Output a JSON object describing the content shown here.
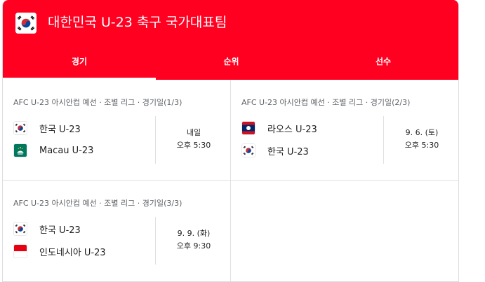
{
  "header": {
    "title": "대한민국 U-23 축구 국가대표팀",
    "tabs": [
      {
        "label": "경기",
        "active": true
      },
      {
        "label": "순위",
        "active": false
      },
      {
        "label": "선수",
        "active": false
      }
    ],
    "background_color": "#ff0021"
  },
  "matches": [
    {
      "competition": "AFC U-23 아시안컵 예선 · 조별 리그 · 경기일(1/3)",
      "teams": [
        {
          "name": "한국 U-23",
          "flag": "south-korea-flag-icon"
        },
        {
          "name": "Macau U-23",
          "flag": "macau-flag-icon"
        }
      ],
      "date": "내일",
      "time": "오후 5:30"
    },
    {
      "competition": "AFC U-23 아시안컵 예선 · 조별 리그 · 경기일(2/3)",
      "teams": [
        {
          "name": "라오스 U-23",
          "flag": "laos-flag-icon"
        },
        {
          "name": "한국 U-23",
          "flag": "south-korea-flag-icon"
        }
      ],
      "date": "9. 6. (토)",
      "time": "오후 5:30"
    },
    {
      "competition": "AFC U-23 아시안컵 예선 · 조별 리그 · 경기일(3/3)",
      "teams": [
        {
          "name": "한국 U-23",
          "flag": "south-korea-flag-icon"
        },
        {
          "name": "인도네시아 U-23",
          "flag": "indonesia-flag-icon"
        }
      ],
      "date": "9. 9. (화)",
      "time": "오후 9:30"
    }
  ]
}
